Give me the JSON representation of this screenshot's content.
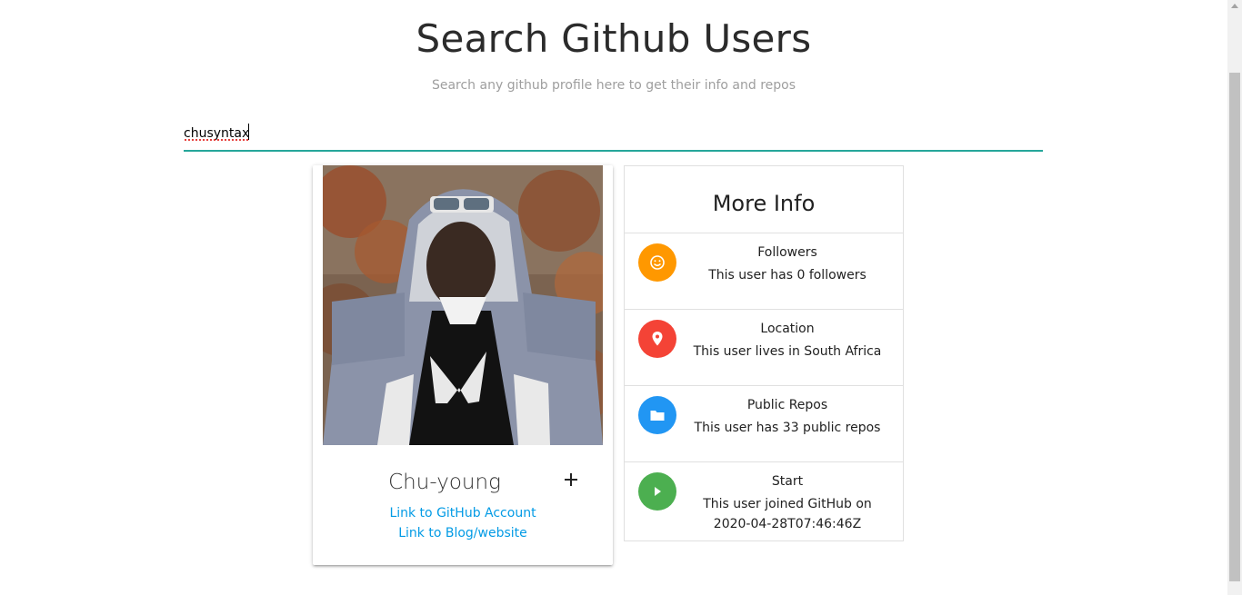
{
  "header": {
    "title": "Search Github Users",
    "subtitle": "Search any github profile here to get their info and repos"
  },
  "search": {
    "value": "chusyntax",
    "accent_color": "#26a69a"
  },
  "profile": {
    "name": "Chu-young",
    "github_link": "Link to GitHub Account",
    "blog_link": "Link to Blog/website",
    "expand_icon": "plus-icon"
  },
  "more_info": {
    "heading": "More Info",
    "items": [
      {
        "icon": "smile-icon",
        "color": "#ff9800",
        "title": "Followers",
        "desc": "This user has 0 followers"
      },
      {
        "icon": "location-pin-icon",
        "color": "#f44336",
        "title": "Location",
        "desc": "This user lives in South Africa"
      },
      {
        "icon": "folder-icon",
        "color": "#2196f3",
        "title": "Public Repos",
        "desc": "This user has 33 public repos"
      },
      {
        "icon": "play-icon",
        "color": "#4caf50",
        "title": "Start",
        "desc": "This user joined GitHub on 2020-04-28T07:46:46Z"
      }
    ]
  }
}
